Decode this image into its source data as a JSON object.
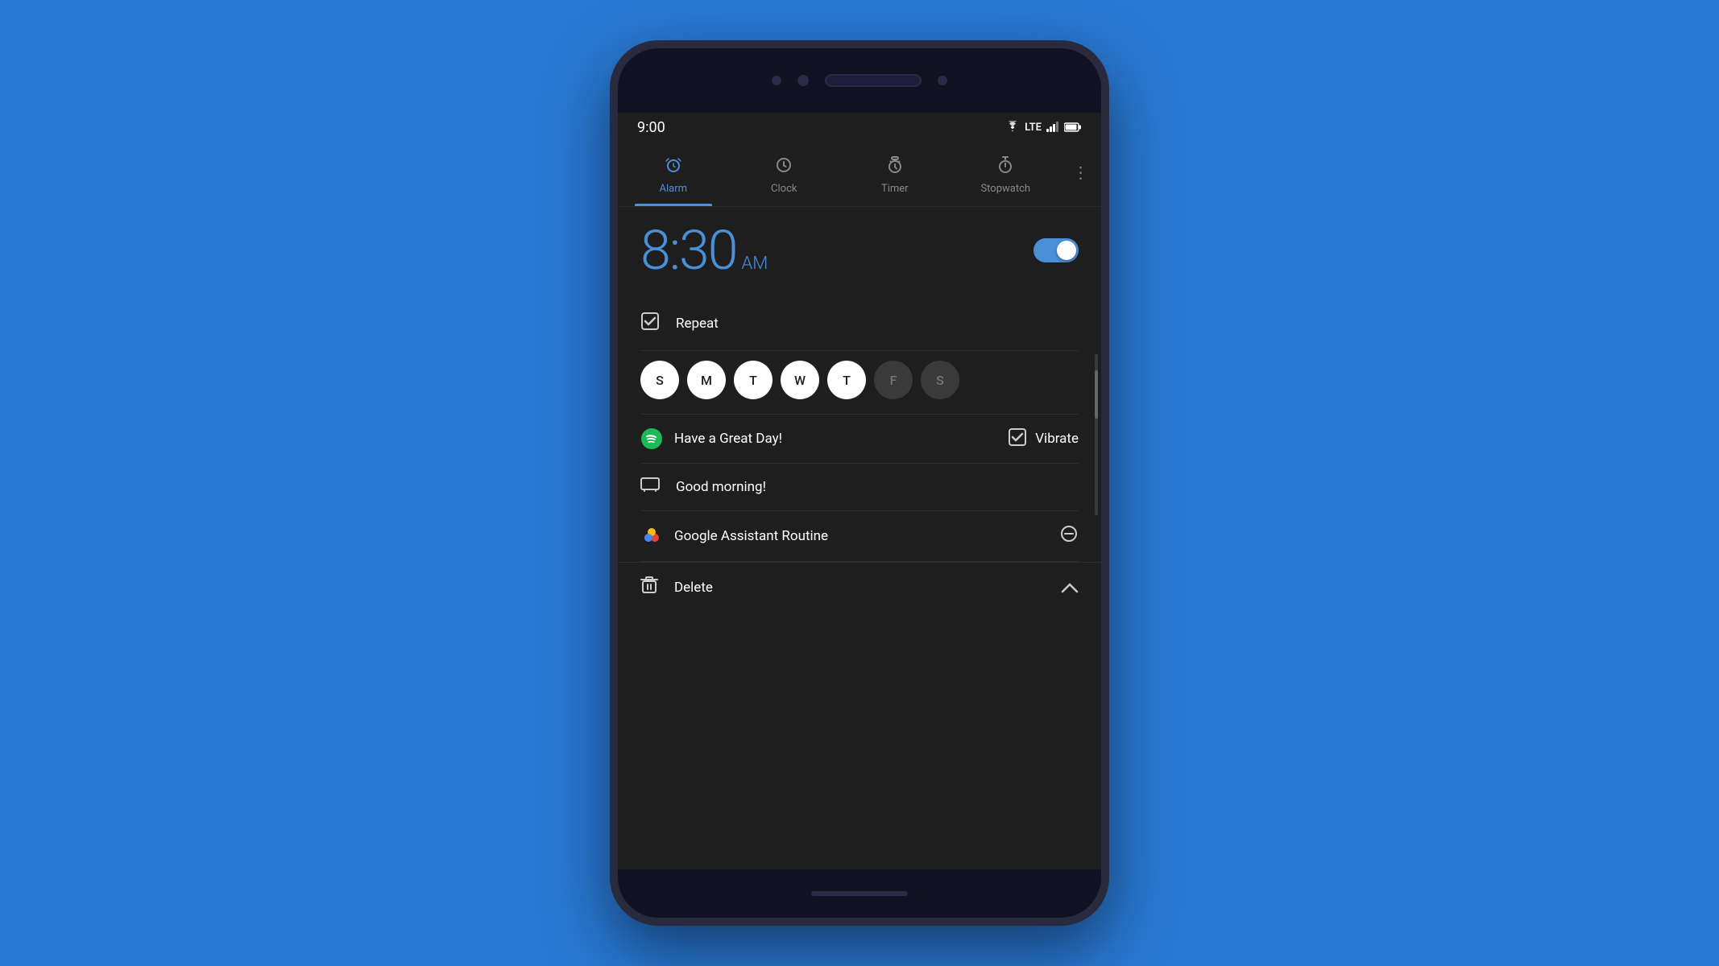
{
  "background": {
    "color": "#2979d4"
  },
  "phone": {
    "status_bar": {
      "time": "9:00",
      "wifi": "▼",
      "lte": "LTE",
      "signal": "▲",
      "battery": "▮"
    },
    "nav": {
      "tabs": [
        {
          "id": "alarm",
          "label": "Alarm",
          "active": true
        },
        {
          "id": "clock",
          "label": "Clock",
          "active": false
        },
        {
          "id": "timer",
          "label": "Timer",
          "active": false
        },
        {
          "id": "stopwatch",
          "label": "Stopwatch",
          "active": false
        }
      ],
      "more_icon": "⋮"
    },
    "alarm": {
      "time": "8:30",
      "ampm": "AM",
      "toggle_on": true,
      "repeat": {
        "label": "Repeat",
        "checked": true
      },
      "days": [
        {
          "letter": "S",
          "active": true
        },
        {
          "letter": "M",
          "active": true
        },
        {
          "letter": "T",
          "active": true
        },
        {
          "letter": "W",
          "active": true
        },
        {
          "letter": "T",
          "active": true
        },
        {
          "letter": "F",
          "active": false
        },
        {
          "letter": "S",
          "active": false
        }
      ],
      "music": {
        "label": "Have a Great Day!"
      },
      "vibrate": {
        "label": "Vibrate",
        "checked": true
      },
      "snooze": {
        "label": "Good morning!"
      },
      "assistant": {
        "label": "Google Assistant Routine"
      },
      "delete": {
        "label": "Delete"
      }
    }
  }
}
